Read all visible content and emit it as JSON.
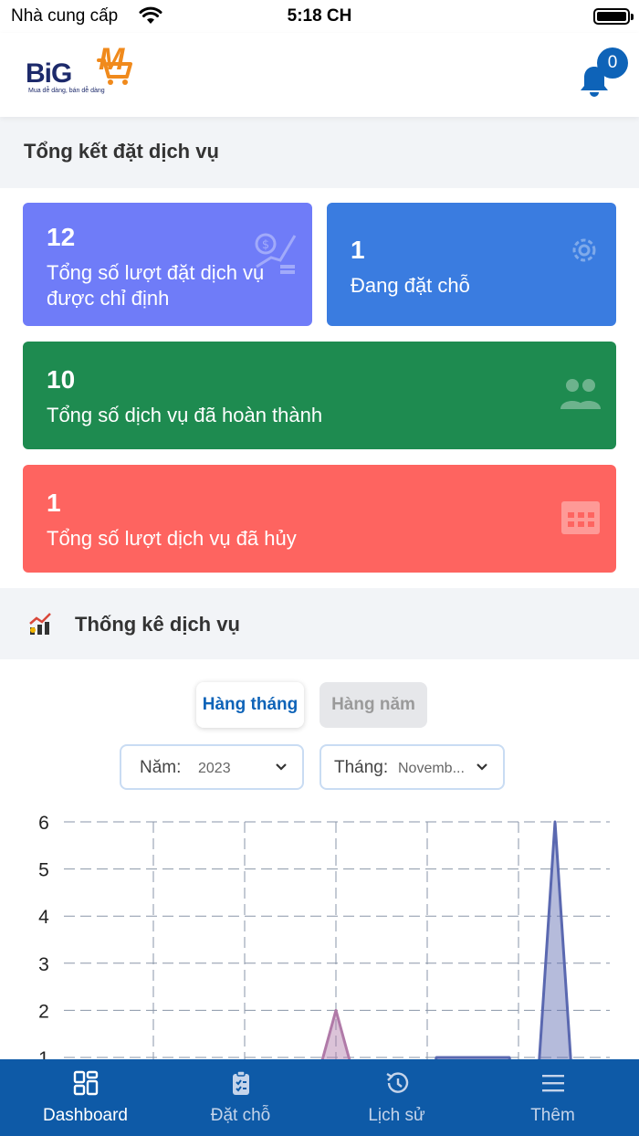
{
  "status_bar": {
    "carrier": "Nhà cung cấp",
    "time": "5:18 CH"
  },
  "header": {
    "logo": {
      "text": "BiG",
      "accent": "M",
      "tagline": "Mua dễ dàng, bán dễ dàng"
    },
    "notification_count": "0"
  },
  "summary": {
    "title": "Tổng kết đặt dịch vụ",
    "cards": [
      {
        "value": "12",
        "label": "Tổng số lượt đặt dịch vụ được chỉ định",
        "color": "#6f7cf8",
        "icon": "money-growth-icon"
      },
      {
        "value": "1",
        "label": "Đang đặt chỗ",
        "color": "#3a7ce0",
        "icon": "gear-icon"
      },
      {
        "value": "10",
        "label": "Tổng số dịch vụ đã hoàn thành",
        "color": "#1e8b50",
        "icon": "people-icon"
      },
      {
        "value": "1",
        "label": "Tổng số lượt dịch vụ đã hủy",
        "color": "#fe6460",
        "icon": "calendar-icon"
      }
    ]
  },
  "stats": {
    "title": "Thống kê dịch vụ",
    "tabs": {
      "monthly": "Hàng tháng",
      "yearly": "Hàng năm",
      "active": "monthly"
    },
    "year_select": {
      "label": "Năm:",
      "value": "2023"
    },
    "month_select": {
      "label": "Tháng:",
      "value": "Novemb..."
    }
  },
  "chart_data": {
    "type": "area",
    "y_ticks": [
      "6",
      "5",
      "4",
      "3",
      "2",
      "1"
    ],
    "ylim": [
      0,
      6
    ],
    "grid": true,
    "series": [
      {
        "values": [
          {
            "x": 3,
            "y": 2
          }
        ],
        "color": "#b07aa8"
      },
      {
        "values": [
          {
            "x": 4.5,
            "y": 1
          }
        ],
        "color": "#5a68b0"
      },
      {
        "values": [
          {
            "x": 5.4,
            "y": 6
          }
        ],
        "color": "#5a68b0"
      }
    ]
  },
  "tabbar": {
    "items": [
      {
        "label": "Dashboard",
        "icon": "dashboard-icon",
        "active": true
      },
      {
        "label": "Đặt chỗ",
        "icon": "clipboard-icon",
        "active": false
      },
      {
        "label": "Lịch sử",
        "icon": "history-icon",
        "active": false
      },
      {
        "label": "Thêm",
        "icon": "menu-icon",
        "active": false
      }
    ]
  },
  "colors": {
    "primary": "#0e5aa7",
    "accent": "#f08a1c"
  }
}
